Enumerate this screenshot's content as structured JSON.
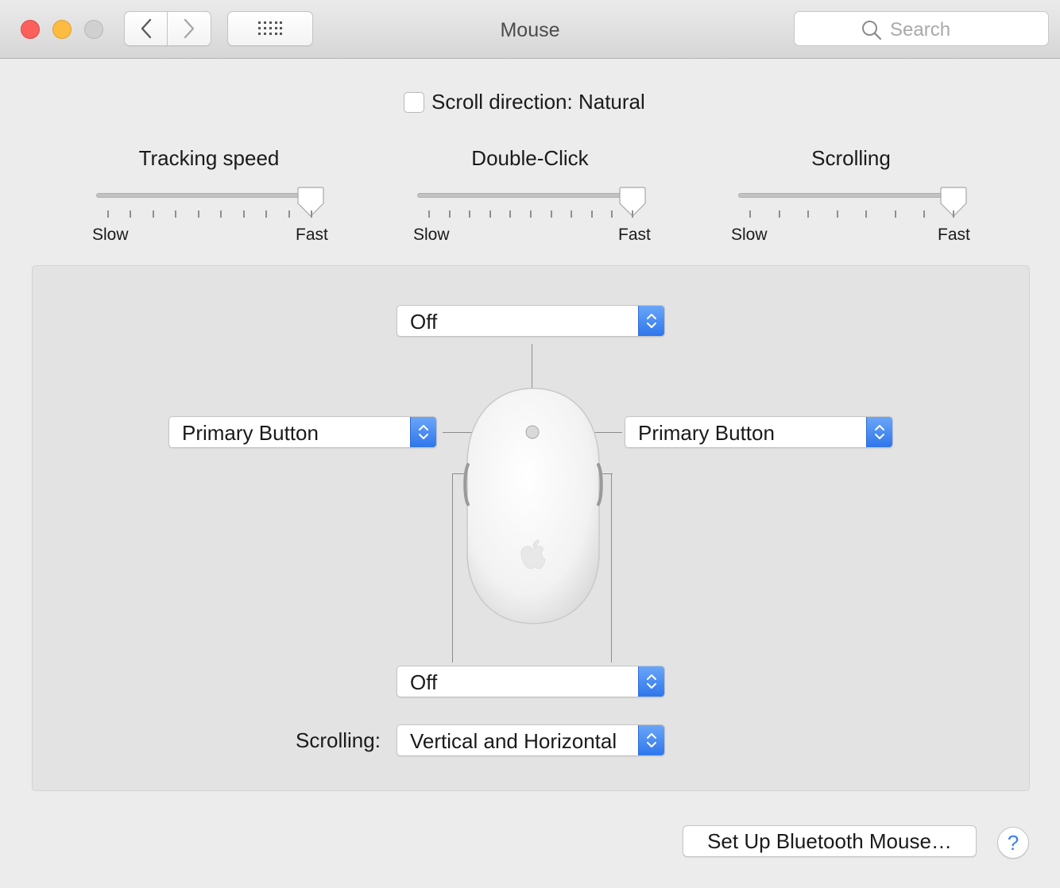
{
  "window": {
    "title": "Mouse",
    "search_placeholder": "Search"
  },
  "scroll_direction": {
    "label": "Scroll direction: Natural",
    "checked": false
  },
  "sliders": [
    {
      "title": "Tracking speed",
      "min_label": "Slow",
      "max_label": "Fast",
      "ticks": 10,
      "value_fraction": 0.92
    },
    {
      "title": "Double-Click",
      "min_label": "Slow",
      "max_label": "Fast",
      "ticks": 11,
      "value_fraction": 0.94
    },
    {
      "title": "Scrolling",
      "min_label": "Slow",
      "max_label": "Fast",
      "ticks": 8,
      "value_fraction": 0.95
    }
  ],
  "mouse_config": {
    "top_popup": "Off",
    "left_popup": "Primary Button",
    "right_popup": "Primary Button",
    "bottom_popup": "Off",
    "scrolling_label": "Scrolling:",
    "scrolling_popup": "Vertical and Horizontal"
  },
  "bottom": {
    "bluetooth_button": "Set Up Bluetooth Mouse…",
    "help_button": "?"
  },
  "colors": {
    "accent": "#3b7ff2",
    "close": "#fc605b",
    "minimize": "#fdbc40",
    "zoom_disabled": "#d0d0d0"
  }
}
